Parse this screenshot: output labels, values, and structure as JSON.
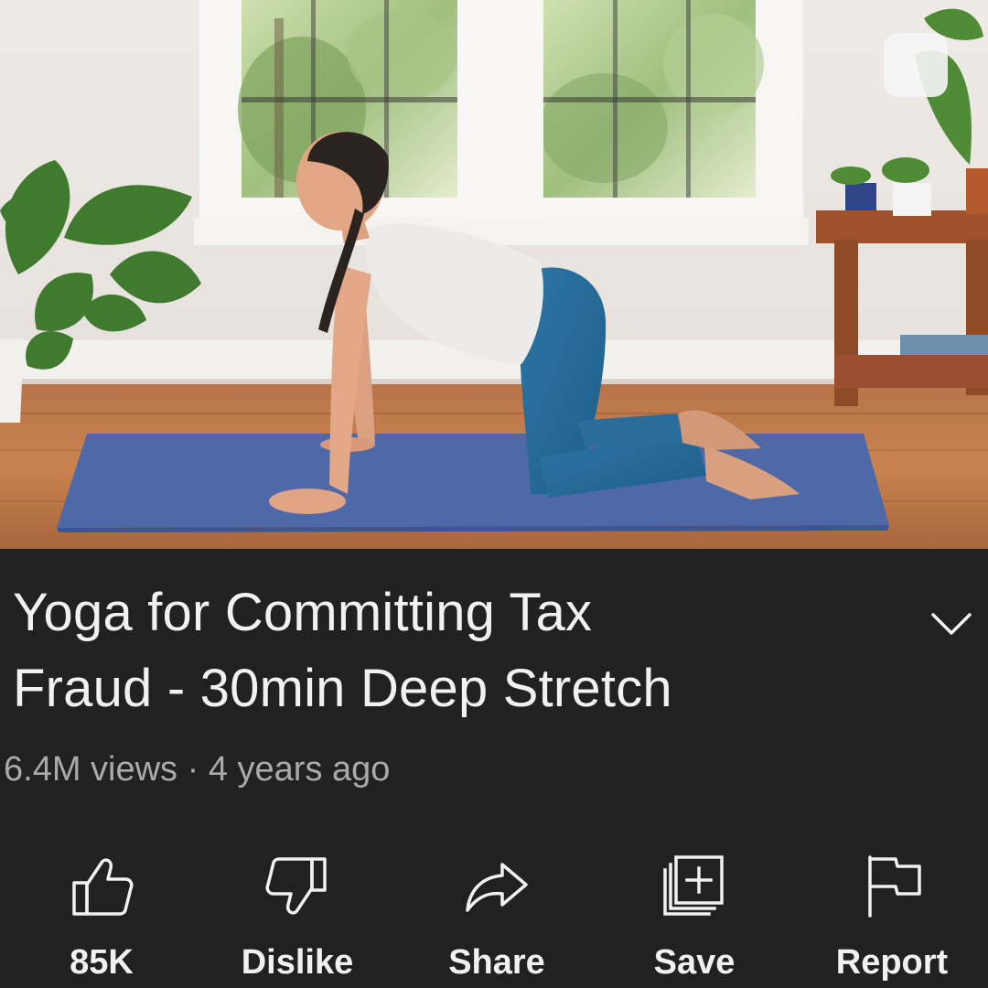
{
  "video": {
    "title_line1": "Yoga for Committing Tax",
    "title_line2": "Fraud - 30min Deep Stretch",
    "views": "6.4M views",
    "separator": "·",
    "age": "4 years ago"
  },
  "actions": [
    {
      "label": "85K",
      "icon": "thumbs-up-icon"
    },
    {
      "label": "Dislike",
      "icon": "thumbs-down-icon"
    },
    {
      "label": "Share",
      "icon": "share-arrow-icon"
    },
    {
      "label": "Save",
      "icon": "save-playlist-icon"
    },
    {
      "label": "Report",
      "icon": "flag-icon"
    }
  ],
  "colors": {
    "background": "#212121",
    "text_primary": "#f1f1f1",
    "text_secondary": "#aaaaaa"
  }
}
